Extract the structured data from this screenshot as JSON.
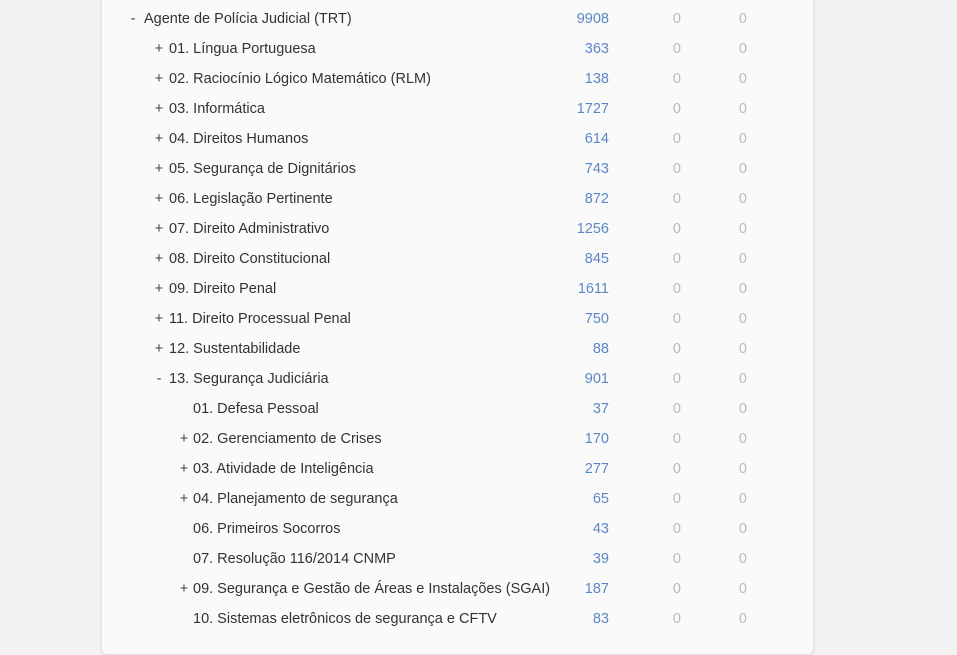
{
  "tree": [
    {
      "toggle": "-",
      "label": "Agente de Polícia Judicial (TRT)",
      "count": "9908",
      "col2": "0",
      "col3": "0",
      "depth": 0
    },
    {
      "toggle": "+",
      "label": "01. Língua Portuguesa",
      "count": "363",
      "col2": "0",
      "col3": "0",
      "depth": 1
    },
    {
      "toggle": "+",
      "label": "02. Raciocínio Lógico Matemático (RLM)",
      "count": "138",
      "col2": "0",
      "col3": "0",
      "depth": 1
    },
    {
      "toggle": "+",
      "label": "03. Informática",
      "count": "1727",
      "col2": "0",
      "col3": "0",
      "depth": 1
    },
    {
      "toggle": "+",
      "label": "04. Direitos Humanos",
      "count": "614",
      "col2": "0",
      "col3": "0",
      "depth": 1
    },
    {
      "toggle": "+",
      "label": "05. Segurança de Dignitários",
      "count": "743",
      "col2": "0",
      "col3": "0",
      "depth": 1
    },
    {
      "toggle": "+",
      "label": "06. Legislação Pertinente",
      "count": "872",
      "col2": "0",
      "col3": "0",
      "depth": 1
    },
    {
      "toggle": "+",
      "label": "07. Direito Administrativo",
      "count": "1256",
      "col2": "0",
      "col3": "0",
      "depth": 1
    },
    {
      "toggle": "+",
      "label": "08. Direito Constitucional",
      "count": "845",
      "col2": "0",
      "col3": "0",
      "depth": 1
    },
    {
      "toggle": "+",
      "label": "09. Direito Penal",
      "count": "1611",
      "col2": "0",
      "col3": "0",
      "depth": 1
    },
    {
      "toggle": "+",
      "label": "11. Direito Processual Penal",
      "count": "750",
      "col2": "0",
      "col3": "0",
      "depth": 1
    },
    {
      "toggle": "+",
      "label": "12. Sustentabilidade",
      "count": "88",
      "col2": "0",
      "col3": "0",
      "depth": 1
    },
    {
      "toggle": "-",
      "label": "13. Segurança Judiciária",
      "count": "901",
      "col2": "0",
      "col3": "0",
      "depth": 1
    },
    {
      "toggle": "",
      "label": "01. Defesa Pessoal",
      "count": "37",
      "col2": "0",
      "col3": "0",
      "depth": 2
    },
    {
      "toggle": "+",
      "label": "02. Gerenciamento de Crises",
      "count": "170",
      "col2": "0",
      "col3": "0",
      "depth": 2
    },
    {
      "toggle": "+",
      "label": "03. Atividade de Inteligência",
      "count": "277",
      "col2": "0",
      "col3": "0",
      "depth": 2
    },
    {
      "toggle": "+",
      "label": "04. Planejamento de segurança",
      "count": "65",
      "col2": "0",
      "col3": "0",
      "depth": 2
    },
    {
      "toggle": "",
      "label": "06. Primeiros Socorros",
      "count": "43",
      "col2": "0",
      "col3": "0",
      "depth": 2
    },
    {
      "toggle": "",
      "label": "07. Resolução 116/2014 CNMP",
      "count": "39",
      "col2": "0",
      "col3": "0",
      "depth": 2
    },
    {
      "toggle": "+",
      "label": "09. Segurança e Gestão de Áreas e Instalações (SGAI)",
      "count": "187",
      "col2": "0",
      "col3": "0",
      "depth": 2
    },
    {
      "toggle": "",
      "label": "10. Sistemas eletrônicos de segurança e CFTV",
      "count": "83",
      "col2": "0",
      "col3": "0",
      "depth": 2
    }
  ]
}
